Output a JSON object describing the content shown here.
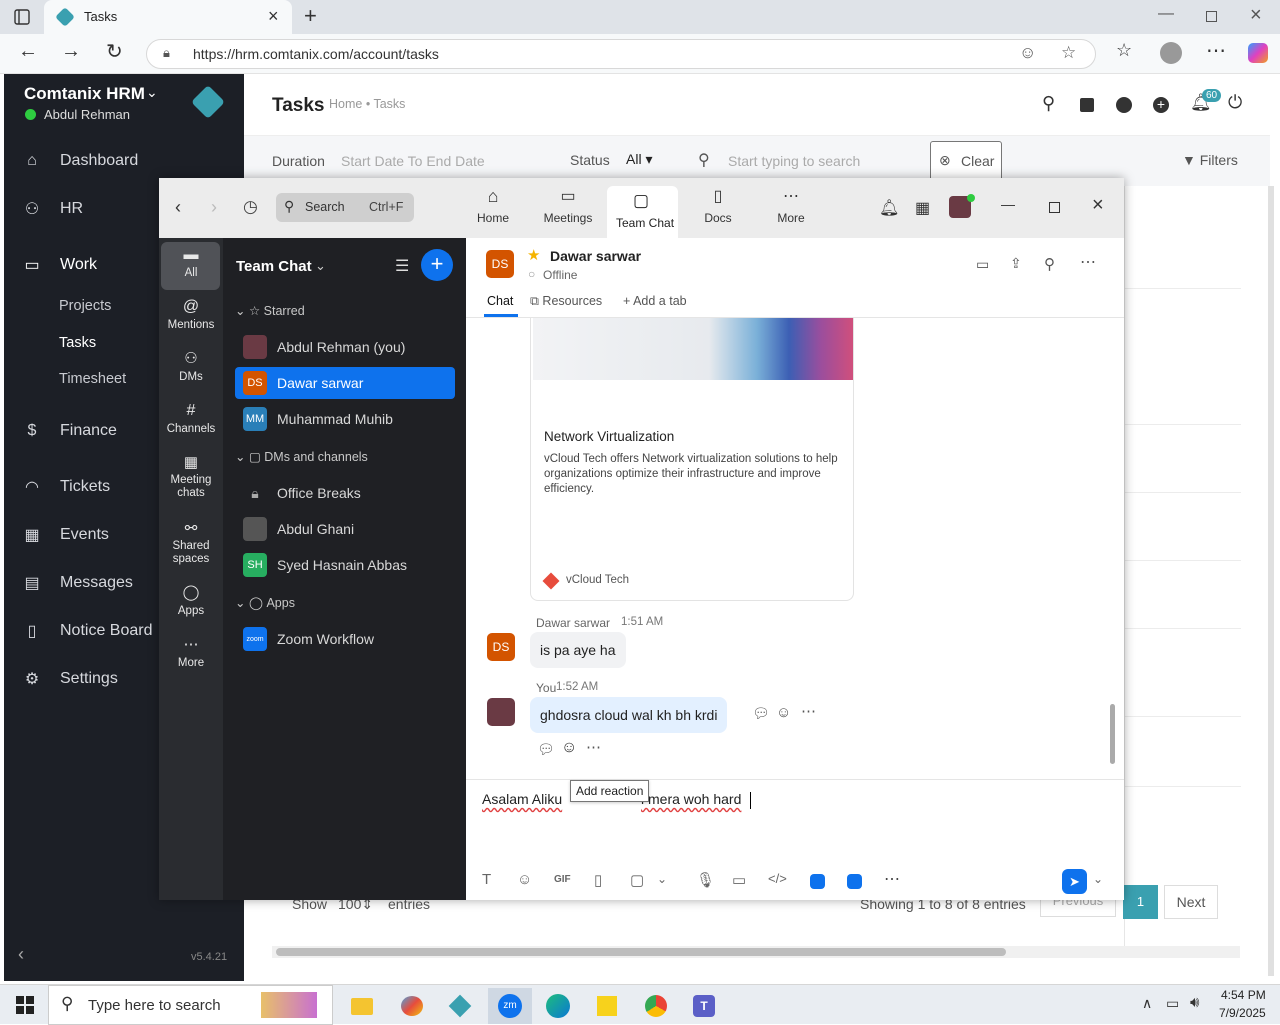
{
  "browser": {
    "tab_title": "Tasks",
    "url": "https://hrm.comtanix.com/account/tasks"
  },
  "sidebar": {
    "company": "Comtanix HRM",
    "user": "Abdul Rehman",
    "items": [
      {
        "label": "Dashboard",
        "icon": "home-icon"
      },
      {
        "label": "HR",
        "icon": "people-icon"
      },
      {
        "label": "Work",
        "icon": "briefcase-icon"
      },
      {
        "label": "Finance",
        "icon": "dollar-icon"
      },
      {
        "label": "Tickets",
        "icon": "headset-icon"
      },
      {
        "label": "Events",
        "icon": "calendar-icon"
      },
      {
        "label": "Messages",
        "icon": "message-icon"
      },
      {
        "label": "Notice Board",
        "icon": "clipboard-icon"
      },
      {
        "label": "Settings",
        "icon": "gear-icon"
      }
    ],
    "sub_items": [
      "Projects",
      "Tasks",
      "Timesheet"
    ],
    "version": "v5.4.21"
  },
  "page": {
    "title": "Tasks",
    "breadcrumb_home": "Home",
    "breadcrumb_sep": "•",
    "breadcrumb_current": "Tasks",
    "notification_count": "60"
  },
  "filters": {
    "duration_label": "Duration",
    "duration_value": "Start Date To End Date",
    "status_label": "Status",
    "status_value": "All",
    "search_placeholder": "Start typing to search",
    "clear_label": "Clear",
    "filters_label": "Filters"
  },
  "table_footer": {
    "show_label": "Show",
    "show_value": "100",
    "entries_label": "entries",
    "showing_text": "Showing 1 to 8 of 8 entries",
    "previous_label": "Previous",
    "page": "1",
    "next_label": "Next"
  },
  "zoom": {
    "search_label": "Search",
    "search_shortcut": "Ctrl+F",
    "tabs": [
      "Home",
      "Meetings",
      "Team Chat",
      "Docs",
      "More"
    ],
    "rail": [
      "All",
      "Mentions",
      "DMs",
      "Channels",
      "Meeting chats",
      "Shared spaces",
      "Apps",
      "More"
    ],
    "list_title": "Team Chat",
    "sections": {
      "starred": "Starred",
      "dms": "DMs and channels",
      "apps": "Apps"
    },
    "starred": [
      {
        "name": "Abdul Rehman (you)",
        "initials": ""
      },
      {
        "name": "Dawar sarwar",
        "initials": "DS"
      },
      {
        "name": "Muhammad Muhib",
        "initials": "MM"
      }
    ],
    "dms": [
      {
        "name": "Office Breaks",
        "initials": ""
      },
      {
        "name": "Abdul Ghani",
        "initials": ""
      },
      {
        "name": "Syed Hasnain Abbas",
        "initials": "SH"
      }
    ],
    "apps": [
      {
        "name": "Zoom Workflow",
        "initials": "zoom"
      }
    ],
    "chat": {
      "contact": "Dawar sarwar",
      "contact_initials": "DS",
      "status": "Offline",
      "tabs": [
        "Chat",
        "Resources",
        "Add a tab"
      ],
      "card_title": "Network Virtualization",
      "card_desc": "vCloud Tech offers Network virtualization solutions to help organizations optimize their infrastructure and improve efficiency.",
      "card_source": "vCloud Tech",
      "msg1_sender": "Dawar sarwar",
      "msg1_time": "1:51 AM",
      "msg1_text": "is pa aye ha",
      "msg2_sender": "You",
      "msg2_time": "1:52 AM",
      "msg2_text": "ghdosra cloud wal kh bh krdi",
      "tooltip": "Add reaction",
      "compose_visible_1": "Asalam Aliku",
      "compose_visible_2": "i mera woh hard"
    }
  },
  "taskbar": {
    "search_placeholder": "Type here to search",
    "time": "4:54 PM",
    "date": "7/9/2025"
  }
}
